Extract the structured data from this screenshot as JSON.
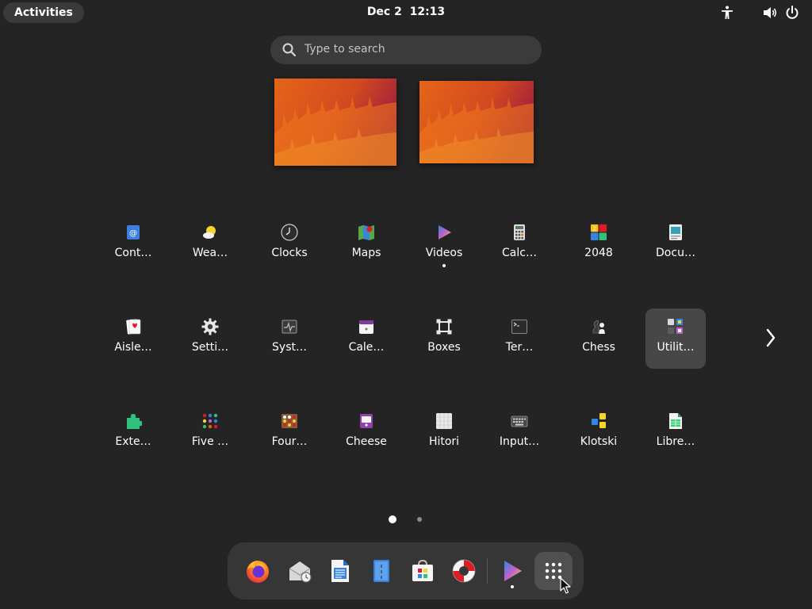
{
  "topbar": {
    "activities_label": "Activities",
    "date": "Dec 2",
    "time": "12:13",
    "tray_icons": [
      "accessibility-icon",
      "volume-icon",
      "power-icon"
    ]
  },
  "search": {
    "placeholder": "Type to search"
  },
  "workspaces": [
    {
      "name": "Workspace 1"
    },
    {
      "name": "Workspace 2"
    }
  ],
  "app_grid": {
    "rows": [
      [
        {
          "label": "Cont…",
          "icon": "contacts-icon"
        },
        {
          "label": "Wea…",
          "icon": "weather-icon"
        },
        {
          "label": "Clocks",
          "icon": "clocks-icon"
        },
        {
          "label": "Maps",
          "icon": "maps-icon"
        },
        {
          "label": "Videos",
          "icon": "videos-icon",
          "running": true
        },
        {
          "label": "Calc…",
          "icon": "calculator-icon"
        },
        {
          "label": "2048",
          "icon": "2048-icon"
        },
        {
          "label": "Docu…",
          "icon": "document-viewer-icon"
        }
      ],
      [
        {
          "label": "Aisle…",
          "icon": "aisleriot-icon"
        },
        {
          "label": "Setti…",
          "icon": "settings-icon"
        },
        {
          "label": "Syst…",
          "icon": "system-monitor-icon"
        },
        {
          "label": "Cale…",
          "icon": "calendar-icon"
        },
        {
          "label": "Boxes",
          "icon": "boxes-icon"
        },
        {
          "label": "Ter…",
          "icon": "terminal-icon"
        },
        {
          "label": "Chess",
          "icon": "chess-icon"
        },
        {
          "label": "Utilit…",
          "icon": "utilities-folder-icon",
          "selected": true
        }
      ],
      [
        {
          "label": "Exte…",
          "icon": "extensions-icon"
        },
        {
          "label": "Five …",
          "icon": "five-or-more-icon"
        },
        {
          "label": "Four…",
          "icon": "four-in-a-row-icon"
        },
        {
          "label": "Cheese",
          "icon": "cheese-icon"
        },
        {
          "label": "Hitori",
          "icon": "hitori-icon"
        },
        {
          "label": "Input…",
          "icon": "input-method-icon"
        },
        {
          "label": "Klotski",
          "icon": "klotski-icon"
        },
        {
          "label": "Libre…",
          "icon": "libreoffice-calc-icon"
        }
      ]
    ],
    "pages": 2,
    "current_page": 1
  },
  "dock": {
    "items": [
      {
        "name": "Firefox",
        "icon": "firefox-icon"
      },
      {
        "name": "Mail",
        "icon": "mail-icon"
      },
      {
        "name": "Writer",
        "icon": "libreoffice-writer-icon"
      },
      {
        "name": "Files",
        "icon": "text-editor-icon"
      },
      {
        "name": "Software",
        "icon": "software-icon"
      },
      {
        "name": "Help",
        "icon": "help-icon"
      },
      {
        "name": "Videos",
        "icon": "videos-icon",
        "running": true
      },
      {
        "name": "Show Apps",
        "icon": "show-apps-icon"
      }
    ]
  },
  "colors": {
    "background": "#242424",
    "panel": "#363636",
    "selected": "#474747",
    "wallpaper_orange": "#e8621a",
    "wallpaper_red": "#a3223a"
  }
}
